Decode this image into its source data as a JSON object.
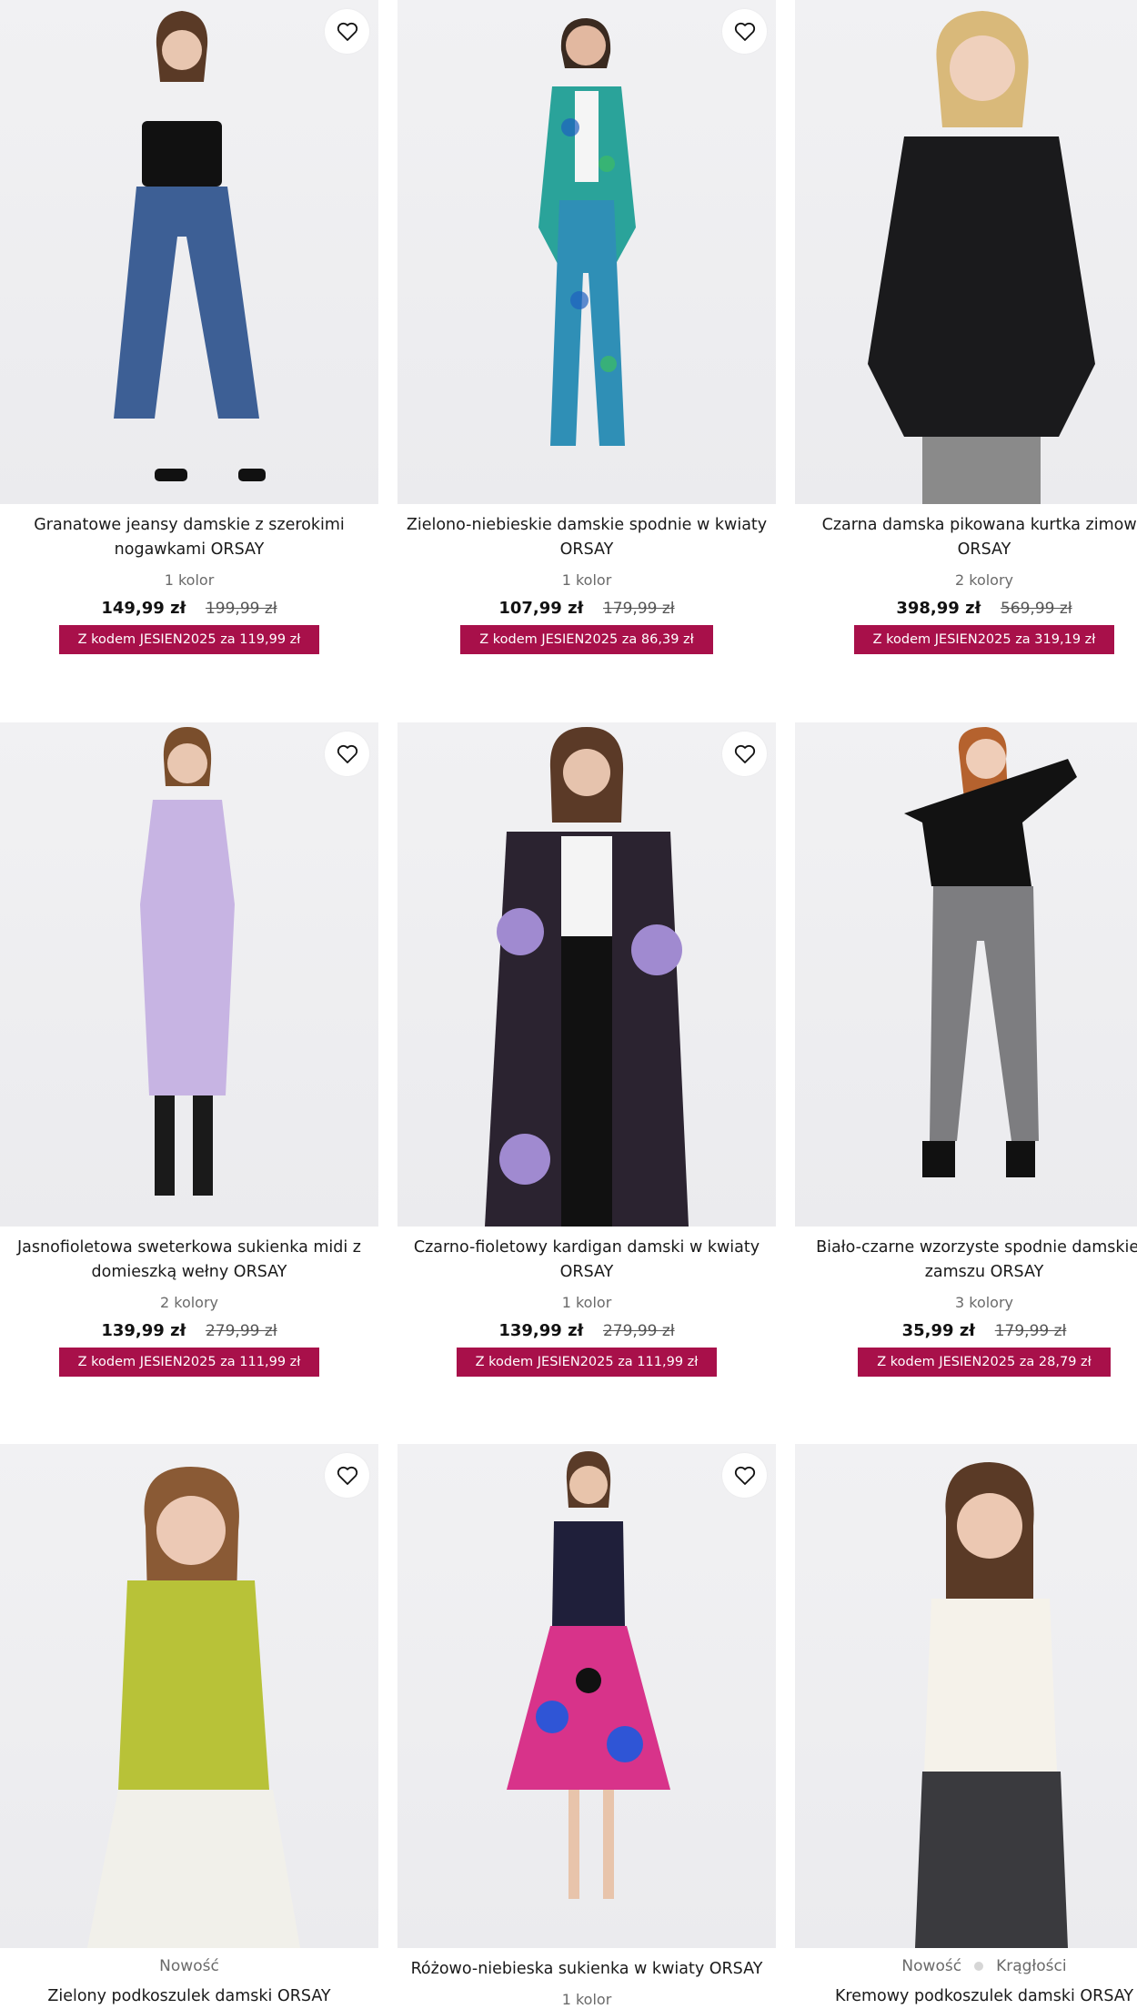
{
  "products": [
    {
      "title": "Granatowe jeansy damskie z szerokimi nogawkami ORSAY",
      "colors": "1 kolor",
      "price": "149,99 zł",
      "old_price": "199,99 zł",
      "promo": "Z kodem JESIEN2025 za 119,99 zł",
      "palette": {
        "top": "#111111",
        "bottom": "#3d5f95",
        "skin": "#e8c6b0",
        "hair": "#5a3a26"
      }
    },
    {
      "title": "Zielono-niebieskie damskie spodnie w kwiaty ORSAY",
      "colors": "1 kolor",
      "price": "107,99 zł",
      "old_price": "179,99 zł",
      "promo": "Z kodem JESIEN2025 za 86,39 zł",
      "palette": {
        "top": "#2aa39a",
        "bottom": "#2f8fb6",
        "skin": "#e2b8a0",
        "hair": "#3a2a20"
      }
    },
    {
      "title": "Czarna damska pikowana kurtka zimowa ORSAY",
      "colors": "2 kolory",
      "price": "398,99 zł",
      "old_price": "569,99 zł",
      "promo": "Z kodem JESIEN2025 za 319,19 zł",
      "palette": {
        "top": "#1a1a1c",
        "bottom": "#8a8a8a",
        "skin": "#efd0bc",
        "hair": "#d9b97a"
      }
    },
    {
      "title": "Jasnofioletowa sweterkowa sukienka midi z domieszką wełny ORSAY",
      "colors": "2 kolory",
      "price": "139,99 zł",
      "old_price": "279,99 zł",
      "promo": "Z kodem JESIEN2025 za 111,99 zł",
      "palette": {
        "top": "#c7b4e3",
        "bottom": "#1a1a1a",
        "skin": "#e9c7b1",
        "hair": "#7a4e2c"
      }
    },
    {
      "title": "Czarno-fioletowy kardigan damski w kwiaty ORSAY",
      "colors": "1 kolor",
      "price": "139,99 zł",
      "old_price": "279,99 zł",
      "promo": "Z kodem JESIEN2025 za 111,99 zł",
      "palette": {
        "top": "#2b2330",
        "bottom": "#111111",
        "skin": "#e6c3ad",
        "hair": "#5b3a27"
      }
    },
    {
      "title": "Biało-czarne wzorzyste spodnie damskie z zamszu ORSAY",
      "colors": "3 kolory",
      "price": "35,99 zł",
      "old_price": "179,99 zł",
      "promo": "Z kodem JESIEN2025 za 28,79 zł",
      "palette": {
        "top": "#121212",
        "bottom": "#7d7d80",
        "skin": "#efcdb8",
        "hair": "#b5622e"
      }
    },
    {
      "title": "Zielony podkoszulek damski ORSAY",
      "badges": [
        "Nowość"
      ],
      "palette": {
        "top": "#b8c238",
        "bottom": "#f1f0ea",
        "skin": "#ecc9b5",
        "hair": "#8a5a35"
      }
    },
    {
      "title": "Różowo-niebieska sukienka w kwiaty ORSAY",
      "colors": "1 kolor",
      "palette": {
        "top": "#1f1f3a",
        "bottom": "#d8338a",
        "skin": "#e8c4ab",
        "hair": "#5a3b28"
      }
    },
    {
      "title": "Kremowy podkoszulek damski ORSAY",
      "badges": [
        "Nowość",
        "Krągłości"
      ],
      "palette": {
        "top": "#f5f2ea",
        "bottom": "#3a3a3e",
        "skin": "#ecc8b2",
        "hair": "#5a3a26"
      }
    }
  ]
}
